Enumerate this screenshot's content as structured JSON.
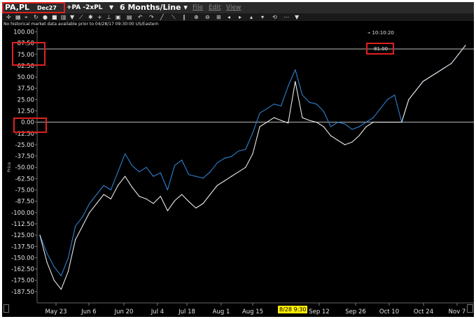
{
  "title_bar": {
    "symbol": "PA,PL",
    "contract": "Dec27",
    "spread": "+PA -2xPL",
    "period": "6 Months/Line",
    "period_caret": "▾",
    "menu": [
      "File",
      "Edit",
      "View"
    ]
  },
  "toolbar": {
    "icons": [
      "crosshair-icon",
      "chart-type-icon",
      "cursor-icon",
      "refresh-icon",
      "record-icon",
      "stop-icon",
      "bar-chart-icon",
      "dropdown-icon",
      "line-chart-icon",
      "settings-icon",
      "add-icon",
      "pin-icon",
      "save-icon",
      "print-icon",
      "undo-icon",
      "redo-icon",
      "draw-line-icon",
      "draw-trend-icon",
      "draw-channel-icon",
      "zoom-in-icon",
      "zoom-out-icon",
      "fit-icon",
      "scroll-left-icon",
      "scroll-right-icon",
      "scroll-up-icon",
      "scroll-down-icon",
      "rotate-icon",
      "more-icon",
      "menu-icon"
    ]
  },
  "notice": "No historical market data available prior to 04/28/17 09:30:00 US/Eastern",
  "clock": "⌁ 10:10:20",
  "y_axis_label": "Price",
  "price_marker": "81.00",
  "badge_date": "8/28 9:30",
  "colors": {
    "background": "#000000",
    "series_a": "#2f80d0",
    "series_b": "#e8e8e8",
    "annotation": "#e02020",
    "badge": "#ffee00",
    "reference_line": "#bbbbbb"
  },
  "chart_data": {
    "type": "line",
    "ylim": [
      -200,
      105
    ],
    "reference_lines": [
      81.0,
      0.0
    ],
    "y_ticks": [
      "100.00",
      "87.50",
      "75.00",
      "62.50",
      "50.00",
      "37.50",
      "25.00",
      "12.50",
      "0.00",
      "-12.50",
      "-25.00",
      "-37.50",
      "-50.00",
      "-62.50",
      "-75.00",
      "-87.50",
      "-100.00",
      "-112.50",
      "-125.00",
      "-137.50",
      "-150.00",
      "-162.50",
      "-175.00",
      "-187.50"
    ],
    "x_ticks": [
      "May 23",
      "Jun 6",
      "Jun 20",
      "Jul 4",
      "Jul 18",
      "Aug 1",
      "Aug 15",
      "Sep 12",
      "Sep 26",
      "Oct 10",
      "Oct 24",
      "Nov 7"
    ],
    "x": [
      "May 16",
      "May 19",
      "May 22",
      "May 25",
      "May 28",
      "May 31",
      "Jun 3",
      "Jun 6",
      "Jun 9",
      "Jun 12",
      "Jun 15",
      "Jun 18",
      "Jun 21",
      "Jun 24",
      "Jun 27",
      "Jun 30",
      "Jul 3",
      "Jul 6",
      "Jul 9",
      "Jul 12",
      "Jul 15",
      "Jul 18",
      "Jul 21",
      "Jul 24",
      "Jul 27",
      "Jul 30",
      "Aug 2",
      "Aug 5",
      "Aug 8",
      "Aug 11",
      "Aug 14",
      "Aug 17",
      "Aug 20",
      "Aug 23",
      "Aug 26",
      "Aug 29",
      "Sep 1",
      "Sep 4",
      "Sep 7",
      "Sep 10",
      "Sep 13",
      "Sep 16",
      "Sep 19",
      "Sep 22",
      "Sep 25",
      "Sep 28",
      "Oct 1",
      "Oct 4",
      "Oct 7",
      "Oct 10",
      "Oct 13",
      "Oct 16",
      "Oct 19",
      "Oct 22",
      "Oct 25",
      "Oct 28",
      "Oct 31",
      "Nov 3",
      "Nov 6",
      "Nov 9",
      "Nov 12"
    ],
    "series": [
      {
        "values": [
          -125,
          -145,
          -160,
          -170,
          -150,
          -115,
          -105,
          -90,
          -80,
          -70,
          -75,
          -55,
          -35,
          -48,
          -55,
          -50,
          -60,
          -56,
          -75,
          -48,
          -42,
          -58,
          -60,
          -62,
          -55,
          -45,
          -40,
          -38,
          -32,
          -30,
          -12,
          10,
          15,
          20,
          18,
          40,
          58,
          30,
          22,
          20,
          12,
          -5,
          0,
          -2,
          -8,
          -5,
          0,
          5,
          15,
          25,
          30,
          0,
          25,
          35,
          45,
          50,
          55,
          60,
          65,
          75,
          85
        ]
      },
      {
        "values": [
          -125,
          -155,
          -175,
          -185,
          -165,
          -130,
          -115,
          -100,
          -90,
          -80,
          -85,
          -70,
          -60,
          -72,
          -82,
          -85,
          -90,
          -82,
          -98,
          -87,
          -80,
          -88,
          -95,
          -90,
          -80,
          -70,
          -65,
          -60,
          -55,
          -50,
          -35,
          -5,
          0,
          5,
          2,
          -1,
          45,
          5,
          2,
          0,
          -5,
          -15,
          -20,
          -25,
          -22,
          -15,
          -5,
          0,
          0,
          0,
          0,
          0,
          25,
          35,
          45,
          50,
          55,
          60,
          65,
          75,
          85
        ]
      }
    ]
  }
}
